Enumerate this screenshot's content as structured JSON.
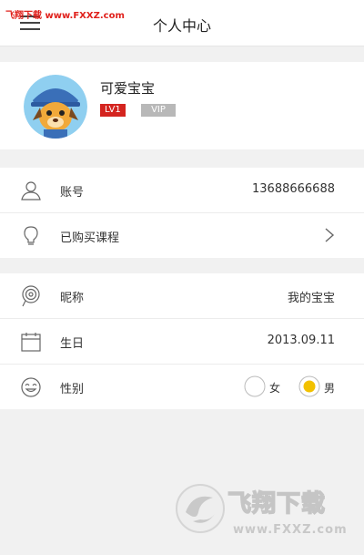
{
  "watermark_top": "飞翔下载 www.FXXZ.com",
  "header": {
    "title": "个人中心"
  },
  "profile": {
    "name": "可爱宝宝",
    "level_badge": "LV1",
    "vip_badge": "VIP"
  },
  "account_group": {
    "account": {
      "label": "账号",
      "value": "13688666688",
      "icon": "user-icon"
    },
    "courses": {
      "label": "已购买课程",
      "icon": "lightbulb-icon"
    }
  },
  "info_group": {
    "nickname": {
      "label": "昵称",
      "value": "我的宝宝",
      "icon": "lollipop-icon"
    },
    "birthday": {
      "label": "生日",
      "value": "2013.09.11",
      "icon": "calendar-icon"
    },
    "gender": {
      "label": "性别",
      "icon": "face-icon",
      "options": [
        "女",
        "男"
      ],
      "selected": "男"
    }
  },
  "watermark_logo": {
    "brand": "飞翔下载",
    "url": "www.FXXZ.com"
  },
  "colors": {
    "accent": "#f2c100",
    "level": "#d4241f",
    "vip": "#b8b8b8",
    "watermark": "#e0201b"
  }
}
